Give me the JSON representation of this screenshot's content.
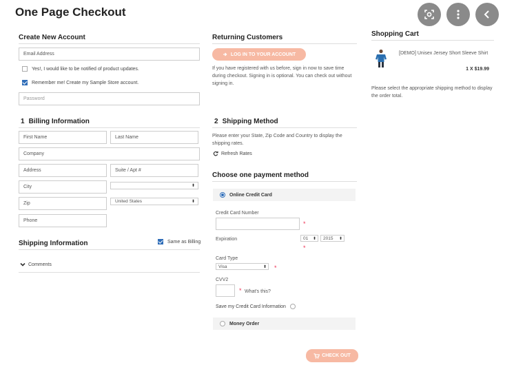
{
  "page": {
    "title": "One Page Checkout"
  },
  "account": {
    "heading": "Create New Account",
    "email_placeholder": "Email Address",
    "notify_label": "Yes!, I would like to be notified of product updates.",
    "remember_label": "Remember me! Create my Sample Store account.",
    "password_placeholder": "Password"
  },
  "returning": {
    "heading": "Returning Customers",
    "login_button": "LOG IN TO YOUR ACCOUNT",
    "info": "If you have registered with us before, sign in now to save time during checkout. Signing in is optional. You can check out without signing in."
  },
  "cart": {
    "heading": "Shopping Cart",
    "item_name": "[DEMO] Unisex Jersey Short Sleeve Shirt",
    "item_qty_price": "1 X $19.99",
    "shipping_note": "Please select the appropriate shipping method to display the order total."
  },
  "billing": {
    "number": "1",
    "heading": "Billing Information",
    "first_name": "First Name",
    "last_name": "Last Name",
    "company": "Company",
    "address": "Address",
    "suite": "Suite / Apt #",
    "city": "City",
    "state": "",
    "zip": "Zip",
    "country": "United States",
    "phone": "Phone"
  },
  "shipping_info": {
    "heading": "Shipping Information",
    "same_as_billing": "Same as Billing",
    "comments": "Comments"
  },
  "shipping_method": {
    "number": "2",
    "heading": "Shipping Method",
    "info": "Please enter your State, Zip Code and Country to display the shipping rates.",
    "refresh": "Refresh Rates"
  },
  "payment": {
    "heading": "Choose one payment method",
    "credit_card_label": "Online Credit Card",
    "card_number_label": "Credit Card Number",
    "expiration_label": "Expiration",
    "exp_month": "01",
    "exp_year": "2015",
    "card_type_label": "Card Type",
    "card_type": "Visa",
    "cvv_label": "CVV2",
    "whats_this": "What's this?",
    "save_card_label": "Save my Credit Card Information",
    "money_order_label": "Money Order"
  },
  "checkout_button": "CHECK OUT",
  "colors": {
    "accent": "#f7b9a3",
    "check": "#2f6db8",
    "required": "#e33355"
  },
  "icons": [
    "lens-icon",
    "more-vert-icon",
    "chevron-left-icon",
    "refresh-icon",
    "chevron-down-icon",
    "cart-icon",
    "login-icon"
  ]
}
